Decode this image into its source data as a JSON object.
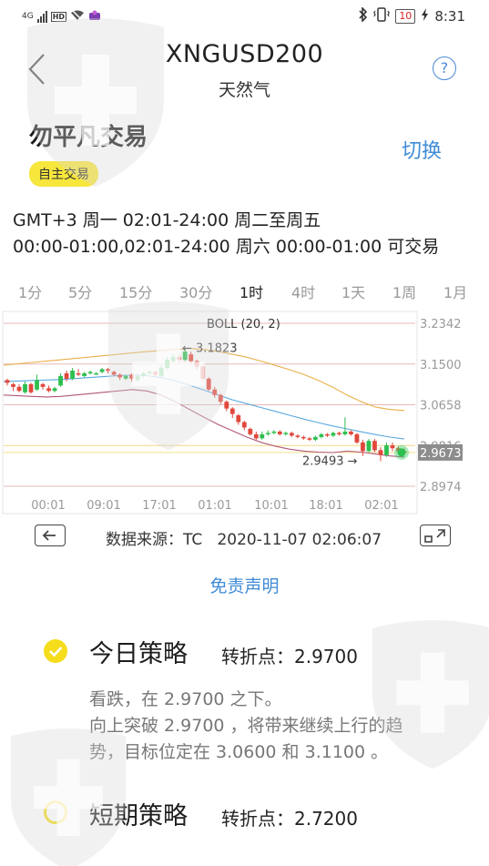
{
  "status_bar": {
    "network": "4G",
    "hd": "HD",
    "battery": "10",
    "time": "8:31"
  },
  "header": {
    "title": "XNGUSD200",
    "subtitle": "天然气",
    "help_symbol": "?"
  },
  "broker": {
    "name": "勿平凡交易",
    "switch_label": "切换",
    "tag": "自主交易"
  },
  "trading_hours": {
    "line1": "GMT+3 周一 02:01-24:00  周二至周五",
    "line2": "00:00-01:00,02:01-24:00  周六 00:00-01:00 可交易"
  },
  "timeframes": {
    "items": [
      "1分",
      "5分",
      "15分",
      "30分",
      "1时",
      "4时",
      "1天",
      "1周",
      "1月"
    ],
    "selected": "1时"
  },
  "chart_data": {
    "type": "candlestick",
    "indicator": "BOLL (20, 2)",
    "y_tick_labels": [
      "3.2342",
      "3.1500",
      "3.0658",
      "2.9816",
      "2.8974"
    ],
    "ylim": [
      2.8974,
      3.2342
    ],
    "current_price": "2.9673",
    "annotations": [
      {
        "text": "← 3.1823",
        "value": 3.1823
      },
      {
        "text": "2.9493 →",
        "value": 2.9493
      }
    ],
    "x_tick_labels": [
      "00:01",
      "09:01",
      "17:01",
      "01:01",
      "10:01",
      "18:01",
      "02:01"
    ],
    "colors": {
      "up": "#2dbf4f",
      "down": "#e0483c",
      "upper_band": "#e8b04a",
      "middle_band": "#5aa8e0",
      "lower_band": "#b0567a",
      "grid": "#e7b7b7",
      "current_price_bg": "#8c8c8c"
    },
    "candles": [
      [
        3.1168,
        3.1112,
        3.1196,
        3.1056
      ],
      [
        3.1084,
        3.1028,
        3.1112,
        3.0944
      ],
      [
        3.1028,
        3.0944,
        3.1084,
        3.0916
      ],
      [
        3.0916,
        3.1084,
        3.114,
        3.0888
      ],
      [
        3.1084,
        3.0916,
        3.1112,
        3.0888
      ],
      [
        3.0972,
        3.1168,
        3.128,
        3.0944
      ],
      [
        3.1084,
        3.1028,
        3.1112,
        3.0972
      ],
      [
        3.1,
        3.0944,
        3.1056,
        3.0916
      ],
      [
        3.0944,
        3.1,
        3.1028,
        3.0916
      ],
      [
        3.1056,
        3.1252,
        3.1308,
        3.1028
      ],
      [
        3.1308,
        3.1196,
        3.1364,
        3.114
      ],
      [
        3.1196,
        3.1364,
        3.142,
        3.1168
      ],
      [
        3.1308,
        3.128,
        3.1392,
        3.1252
      ],
      [
        3.1252,
        3.1308,
        3.1336,
        3.1224
      ],
      [
        3.1308,
        3.1336,
        3.1364,
        3.128
      ],
      [
        3.1308,
        3.1308,
        3.1336,
        3.128
      ],
      [
        3.1336,
        3.1392,
        3.142,
        3.1308
      ],
      [
        3.1392,
        3.1364,
        3.142,
        3.1308
      ],
      [
        3.1336,
        3.128,
        3.1364,
        3.1252
      ],
      [
        3.128,
        3.1224,
        3.1308,
        3.1168
      ],
      [
        3.1196,
        3.1252,
        3.128,
        3.1168
      ],
      [
        3.128,
        3.1196,
        3.1308,
        3.114
      ],
      [
        3.1168,
        3.1252,
        3.1308,
        3.114
      ],
      [
        3.1252,
        3.1308,
        3.1336,
        3.1224
      ],
      [
        3.1308,
        3.1336,
        3.1364,
        3.128
      ],
      [
        3.1336,
        3.128,
        3.1364,
        3.1252
      ],
      [
        3.1252,
        3.142,
        3.1476,
        3.1224
      ],
      [
        3.142,
        3.1588,
        3.1644,
        3.1392
      ],
      [
        3.156,
        3.1644,
        3.17,
        3.1532
      ],
      [
        3.1644,
        3.1588,
        3.17,
        3.1532
      ],
      [
        3.1588,
        3.1756,
        3.1823,
        3.156
      ],
      [
        3.17,
        3.156,
        3.1756,
        3.1504
      ],
      [
        3.156,
        3.1448,
        3.1588,
        3.1392
      ],
      [
        3.1448,
        3.1196,
        3.1476,
        3.114
      ],
      [
        3.1196,
        3.0972,
        3.1224,
        3.0944
      ],
      [
        3.0972,
        3.086,
        3.1028,
        3.0804
      ],
      [
        3.086,
        3.072,
        3.0888,
        3.0664
      ],
      [
        3.072,
        3.058,
        3.0748,
        3.0524
      ],
      [
        3.058,
        3.0468,
        3.0608,
        3.0384
      ],
      [
        3.044,
        3.03,
        3.0468,
        3.0244
      ],
      [
        3.03,
        3.0188,
        3.0328,
        3.0132
      ],
      [
        3.016,
        3.0048,
        3.0188,
        3.002
      ],
      [
        3.0048,
        2.9964,
        3.0104,
        2.9936
      ],
      [
        2.9964,
        3.0048,
        3.0104,
        2.9936
      ],
      [
        3.0048,
        3.0076,
        3.0132,
        3.002
      ],
      [
        3.0076,
        3.0104,
        3.0132,
        3.0048
      ],
      [
        3.0104,
        3.0048,
        3.0132,
        3.002
      ],
      [
        3.0048,
        3.0076,
        3.0104,
        3.002
      ],
      [
        3.0076,
        3.002,
        3.0104,
        2.9992
      ],
      [
        3.002,
        2.9992,
        3.0048,
        2.9964
      ],
      [
        2.9992,
        2.9964,
        3.002,
        2.9936
      ],
      [
        2.9964,
        2.9936,
        2.9992,
        2.9908
      ],
      [
        2.9936,
        2.9992,
        3.002,
        2.9908
      ],
      [
        2.9992,
        3.0048,
        3.0076,
        2.9964
      ],
      [
        3.0048,
        3.002,
        3.0076,
        2.9992
      ],
      [
        3.002,
        3.0076,
        3.0104,
        2.9992
      ],
      [
        3.0076,
        3.0048,
        3.0104,
        3.002
      ],
      [
        3.0048,
        3.0104,
        3.04,
        3.002
      ],
      [
        3.0104,
        3.0048,
        3.0132,
        3.002
      ],
      [
        3.0048,
        2.988,
        3.0076,
        2.9852
      ],
      [
        2.988,
        2.97,
        2.9936,
        2.96
      ],
      [
        2.97,
        2.9912,
        2.995,
        2.968
      ],
      [
        2.9912,
        2.972,
        2.995,
        2.968
      ],
      [
        2.972,
        2.962,
        2.978,
        2.9493
      ],
      [
        2.962,
        2.982,
        2.988,
        2.958
      ],
      [
        2.982,
        2.976,
        2.988,
        2.97
      ],
      [
        2.976,
        2.97,
        2.98,
        2.966
      ],
      [
        2.97,
        2.9673,
        2.976,
        2.964
      ]
    ],
    "upper_band": [
      3.1476,
      3.1504,
      3.1532,
      3.156,
      3.1588,
      3.1616,
      3.1644,
      3.1672,
      3.17,
      3.1728,
      3.1756,
      3.178,
      3.18,
      3.1823,
      3.18,
      3.176,
      3.17,
      3.164,
      3.156,
      3.147,
      3.138,
      3.128,
      3.116,
      3.102,
      3.086,
      3.072,
      3.061,
      3.056,
      3.054
    ],
    "middle_band": [
      3.114,
      3.115,
      3.116,
      3.117,
      3.118,
      3.12,
      3.122,
      3.124,
      3.126,
      3.127,
      3.126,
      3.122,
      3.115,
      3.106,
      3.096,
      3.086,
      3.076,
      3.068,
      3.06,
      3.052,
      3.044,
      3.036,
      3.029,
      3.022,
      3.016,
      3.01,
      3.004,
      2.999,
      2.995
    ],
    "lower_band": [
      3.086,
      3.0844,
      3.0832,
      3.082,
      3.0832,
      3.086,
      3.0888,
      3.0916,
      3.0944,
      3.0972,
      3.0944,
      3.086,
      3.072,
      3.056,
      3.04,
      3.025,
      3.012,
      2.999,
      2.988,
      2.98,
      2.974,
      2.97,
      2.968,
      2.967,
      2.97,
      2.968,
      2.964,
      2.96,
      2.958
    ]
  },
  "chart_footer": {
    "source_label": "数据来源：TC",
    "timestamp": "2020-11-07 02:06:07",
    "disclaimer": "免责声明"
  },
  "strategies": [
    {
      "title": "今日策略",
      "pivot_label": "转折点：",
      "pivot_value": "2.9700",
      "lines": [
        "看跌，在 2.9700 之下。",
        "向上突破 2.9700 ，将带来继续上行的趋",
        "势，目标位定在 3.0600 和 3.1100 。"
      ],
      "icon_color": "#f5dd1c"
    },
    {
      "title": "短期策略",
      "pivot_label": "转折点：",
      "pivot_value": "2.7200",
      "icon_color": "#f5dd1c"
    }
  ]
}
